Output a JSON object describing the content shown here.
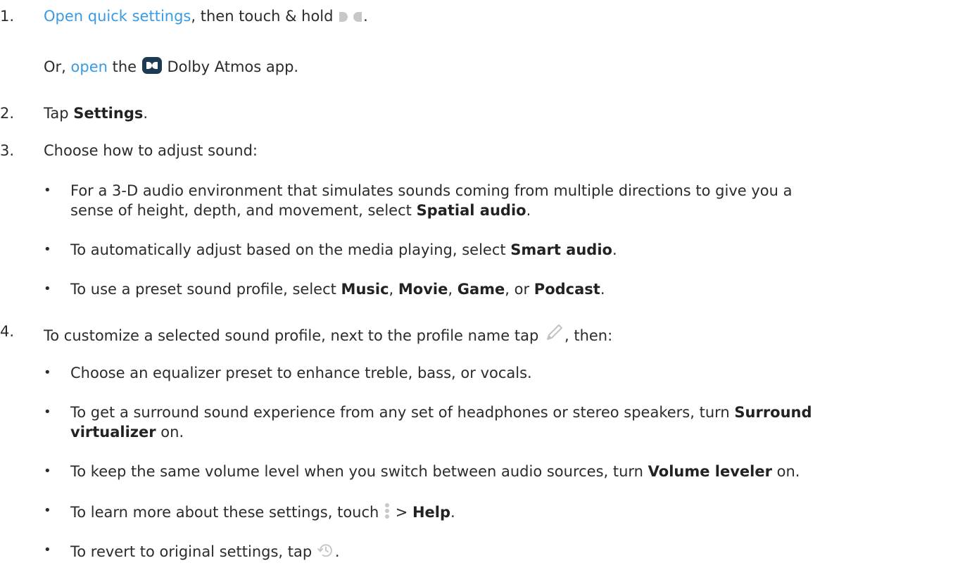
{
  "colors": {
    "link": "#3a9be0",
    "text": "#2b2b2b",
    "icon_gray": "#c8c8c8",
    "app_icon_bg": "#1e3a52"
  },
  "steps": [
    {
      "num": "1.",
      "link1": "Open quick settings",
      "text1": ", then touch & hold",
      "icon1": "dolby-tile-icon",
      "end1": ".",
      "or": "Or, ",
      "link2": "open",
      "the": " the",
      "icon2": "dolby-app-icon",
      "app": " Dolby Atmos app."
    },
    {
      "num": "2.",
      "pre": "Tap ",
      "bold": "Settings",
      "post": "."
    },
    {
      "num": "3.",
      "text": "Choose how to adjust sound:",
      "bullets": [
        {
          "line1": "For a 3-D audio environment that simulates sounds coming from multiple directions to give you a",
          "line2": "sense of height, depth, and movement, select ",
          "bold": "Spatial audio",
          "post": "."
        },
        {
          "pre": "To automatically adjust based on the media playing, select ",
          "bold": "Smart audio",
          "post": "."
        },
        {
          "pre": "To use a preset sound profile, select ",
          "b1": "Music",
          "s1": ", ",
          "b2": "Movie",
          "s2": ", ",
          "b3": "Game",
          "s3": ", or ",
          "b4": "Podcast",
          "post": "."
        }
      ]
    },
    {
      "num": "4.",
      "pre": "To customize a selected sound profile, next to the profile name tap ",
      "icon": "pencil-icon",
      "post": ", then:",
      "bullets": [
        {
          "text": "Choose an equalizer preset to enhance treble, bass, or vocals."
        },
        {
          "line1": "To get a surround sound experience from any set of headphones or stereo speakers, turn ",
          "bold1": "Surround",
          "bold2": "virtualizer",
          "post": " on."
        },
        {
          "pre": "To keep the same volume level when you switch between audio sources, turn ",
          "bold": "Volume leveler",
          "post": " on."
        },
        {
          "pre": "To learn more about these settings, touch ",
          "icon": "more-vert-icon",
          "mid": " > ",
          "bold": "Help",
          "post": "."
        },
        {
          "pre": "To revert to original settings, tap ",
          "icon": "restore-icon",
          "post": "."
        }
      ]
    }
  ],
  "bullet_char": "•"
}
